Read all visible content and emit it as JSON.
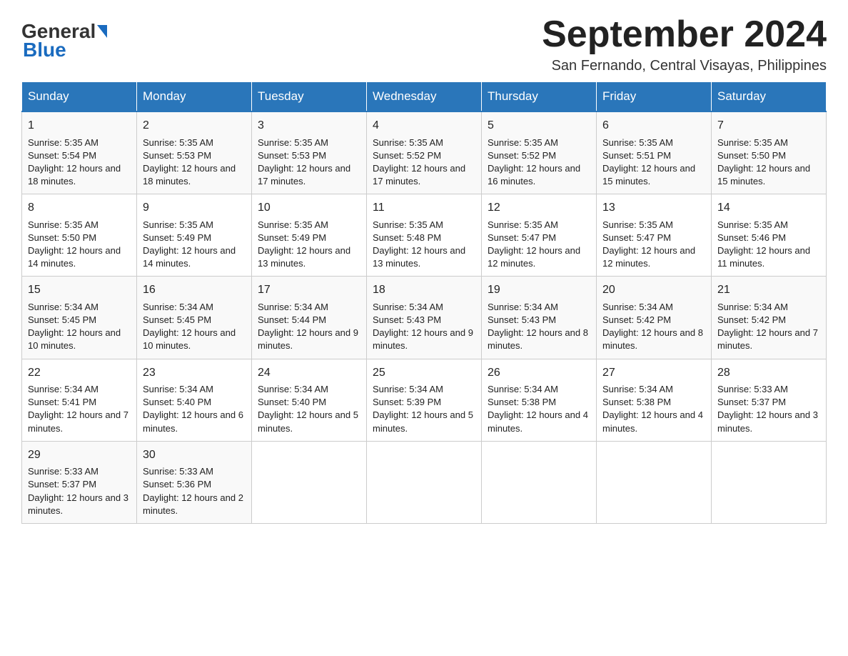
{
  "header": {
    "logo_line1": "General",
    "logo_line2": "Blue",
    "month_title": "September 2024",
    "subtitle": "San Fernando, Central Visayas, Philippines"
  },
  "days_of_week": [
    "Sunday",
    "Monday",
    "Tuesday",
    "Wednesday",
    "Thursday",
    "Friday",
    "Saturday"
  ],
  "weeks": [
    [
      {
        "day": "1",
        "sunrise": "5:35 AM",
        "sunset": "5:54 PM",
        "daylight": "12 hours and 18 minutes."
      },
      {
        "day": "2",
        "sunrise": "5:35 AM",
        "sunset": "5:53 PM",
        "daylight": "12 hours and 18 minutes."
      },
      {
        "day": "3",
        "sunrise": "5:35 AM",
        "sunset": "5:53 PM",
        "daylight": "12 hours and 17 minutes."
      },
      {
        "day": "4",
        "sunrise": "5:35 AM",
        "sunset": "5:52 PM",
        "daylight": "12 hours and 17 minutes."
      },
      {
        "day": "5",
        "sunrise": "5:35 AM",
        "sunset": "5:52 PM",
        "daylight": "12 hours and 16 minutes."
      },
      {
        "day": "6",
        "sunrise": "5:35 AM",
        "sunset": "5:51 PM",
        "daylight": "12 hours and 15 minutes."
      },
      {
        "day": "7",
        "sunrise": "5:35 AM",
        "sunset": "5:50 PM",
        "daylight": "12 hours and 15 minutes."
      }
    ],
    [
      {
        "day": "8",
        "sunrise": "5:35 AM",
        "sunset": "5:50 PM",
        "daylight": "12 hours and 14 minutes."
      },
      {
        "day": "9",
        "sunrise": "5:35 AM",
        "sunset": "5:49 PM",
        "daylight": "12 hours and 14 minutes."
      },
      {
        "day": "10",
        "sunrise": "5:35 AM",
        "sunset": "5:49 PM",
        "daylight": "12 hours and 13 minutes."
      },
      {
        "day": "11",
        "sunrise": "5:35 AM",
        "sunset": "5:48 PM",
        "daylight": "12 hours and 13 minutes."
      },
      {
        "day": "12",
        "sunrise": "5:35 AM",
        "sunset": "5:47 PM",
        "daylight": "12 hours and 12 minutes."
      },
      {
        "day": "13",
        "sunrise": "5:35 AM",
        "sunset": "5:47 PM",
        "daylight": "12 hours and 12 minutes."
      },
      {
        "day": "14",
        "sunrise": "5:35 AM",
        "sunset": "5:46 PM",
        "daylight": "12 hours and 11 minutes."
      }
    ],
    [
      {
        "day": "15",
        "sunrise": "5:34 AM",
        "sunset": "5:45 PM",
        "daylight": "12 hours and 10 minutes."
      },
      {
        "day": "16",
        "sunrise": "5:34 AM",
        "sunset": "5:45 PM",
        "daylight": "12 hours and 10 minutes."
      },
      {
        "day": "17",
        "sunrise": "5:34 AM",
        "sunset": "5:44 PM",
        "daylight": "12 hours and 9 minutes."
      },
      {
        "day": "18",
        "sunrise": "5:34 AM",
        "sunset": "5:43 PM",
        "daylight": "12 hours and 9 minutes."
      },
      {
        "day": "19",
        "sunrise": "5:34 AM",
        "sunset": "5:43 PM",
        "daylight": "12 hours and 8 minutes."
      },
      {
        "day": "20",
        "sunrise": "5:34 AM",
        "sunset": "5:42 PM",
        "daylight": "12 hours and 8 minutes."
      },
      {
        "day": "21",
        "sunrise": "5:34 AM",
        "sunset": "5:42 PM",
        "daylight": "12 hours and 7 minutes."
      }
    ],
    [
      {
        "day": "22",
        "sunrise": "5:34 AM",
        "sunset": "5:41 PM",
        "daylight": "12 hours and 7 minutes."
      },
      {
        "day": "23",
        "sunrise": "5:34 AM",
        "sunset": "5:40 PM",
        "daylight": "12 hours and 6 minutes."
      },
      {
        "day": "24",
        "sunrise": "5:34 AM",
        "sunset": "5:40 PM",
        "daylight": "12 hours and 5 minutes."
      },
      {
        "day": "25",
        "sunrise": "5:34 AM",
        "sunset": "5:39 PM",
        "daylight": "12 hours and 5 minutes."
      },
      {
        "day": "26",
        "sunrise": "5:34 AM",
        "sunset": "5:38 PM",
        "daylight": "12 hours and 4 minutes."
      },
      {
        "day": "27",
        "sunrise": "5:34 AM",
        "sunset": "5:38 PM",
        "daylight": "12 hours and 4 minutes."
      },
      {
        "day": "28",
        "sunrise": "5:33 AM",
        "sunset": "5:37 PM",
        "daylight": "12 hours and 3 minutes."
      }
    ],
    [
      {
        "day": "29",
        "sunrise": "5:33 AM",
        "sunset": "5:37 PM",
        "daylight": "12 hours and 3 minutes."
      },
      {
        "day": "30",
        "sunrise": "5:33 AM",
        "sunset": "5:36 PM",
        "daylight": "12 hours and 2 minutes."
      },
      null,
      null,
      null,
      null,
      null
    ]
  ]
}
